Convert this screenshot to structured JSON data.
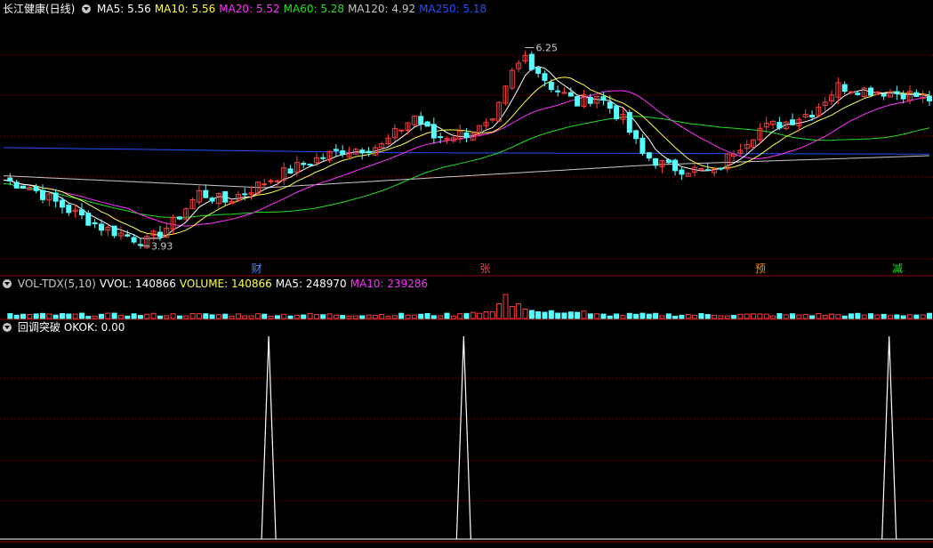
{
  "title": "长江健康(日线)",
  "colors": {
    "bg": "#000000",
    "grid": "#7a0000",
    "divider": "#9a0000",
    "up": "#ff3c3c",
    "down": "#54ffff",
    "ma5": "#ffffff",
    "ma10": "#ffff40",
    "ma20": "#ff30ff",
    "ma60": "#20e020",
    "ma120": "#c8c8c8",
    "ma250": "#2050ff",
    "signal": "#ffffff"
  },
  "main_legend": [
    {
      "label": "MA5: 5.56",
      "color": "#ffffff"
    },
    {
      "label": "MA10: 5.56",
      "color": "#ffff40"
    },
    {
      "label": "MA20: 5.52",
      "color": "#ff30ff"
    },
    {
      "label": "MA60: 5.28",
      "color": "#20e020"
    },
    {
      "label": "MA120: 4.92",
      "color": "#c8c8c8"
    },
    {
      "label": "MA250: 5.18",
      "color": "#2050ff"
    }
  ],
  "vol_legend": [
    {
      "label": "VOL-TDX(5,10)",
      "color": "#c8c8c8"
    },
    {
      "label": "VVOL: 140866",
      "color": "#ffffff"
    },
    {
      "label": "VOLUME: 140866",
      "color": "#ffff40"
    },
    {
      "label": "MA5: 248970",
      "color": "#ffffff"
    },
    {
      "label": "MA10: 239286",
      "color": "#ff30ff"
    }
  ],
  "ind_legend": [
    {
      "label": "回调突破",
      "color": "#ffffff"
    },
    {
      "label": "OKOK: 0.00",
      "color": "#ffffff"
    }
  ],
  "chart_data": {
    "type": "candlestick",
    "price_range": [
      3.6,
      6.6
    ],
    "annotations": [
      {
        "text": "6.25",
        "value": 6.25,
        "kind": "high"
      },
      {
        "text": "3.93",
        "value": 3.93,
        "kind": "low"
      }
    ],
    "event_markers": [
      {
        "text": "财",
        "color": "#4c8cff",
        "frac": 0.275
      },
      {
        "text": "张",
        "color": "#ff3c3c",
        "frac": 0.52
      },
      {
        "text": "预",
        "color": "#ff8c00",
        "frac": 0.815
      },
      {
        "text": "减",
        "color": "#20e020",
        "frac": 0.962
      }
    ],
    "segments": [
      [
        0,
        4.7
      ],
      [
        4,
        4.62
      ],
      [
        10,
        4.35
      ],
      [
        15,
        4.15
      ],
      [
        20,
        4.02
      ],
      [
        22,
        3.98
      ],
      [
        26,
        4.2
      ],
      [
        30,
        4.55
      ],
      [
        34,
        4.45
      ],
      [
        38,
        4.6
      ],
      [
        42,
        4.75
      ],
      [
        47,
        4.92
      ],
      [
        52,
        5.05
      ],
      [
        58,
        5.1
      ],
      [
        63,
        5.45
      ],
      [
        66,
        5.2
      ],
      [
        71,
        5.25
      ],
      [
        75,
        5.35
      ],
      [
        78,
        5.95
      ],
      [
        80,
        6.15
      ],
      [
        84,
        5.8
      ],
      [
        88,
        5.6
      ],
      [
        91,
        5.7
      ],
      [
        95,
        5.4
      ],
      [
        98,
        5.0
      ],
      [
        102,
        4.85
      ],
      [
        106,
        4.82
      ],
      [
        109,
        4.78
      ],
      [
        112,
        5.05
      ],
      [
        116,
        5.3
      ],
      [
        120,
        5.38
      ],
      [
        124,
        5.5
      ],
      [
        128,
        5.8
      ],
      [
        133,
        5.75
      ],
      [
        138,
        5.72
      ],
      [
        142,
        5.65
      ]
    ],
    "volume": {
      "max": 1200000,
      "spikes": [
        [
          76,
          0.55
        ],
        [
          77,
          0.9
        ],
        [
          78,
          0.45
        ],
        [
          79,
          0.55
        ],
        [
          80,
          0.35
        ],
        [
          81,
          0.3
        ],
        [
          82,
          0.25
        ]
      ]
    },
    "indicator": {
      "name": "OKOK",
      "range": [
        0,
        1
      ],
      "spikes_at": [
        0.288,
        0.497,
        0.953
      ]
    }
  }
}
